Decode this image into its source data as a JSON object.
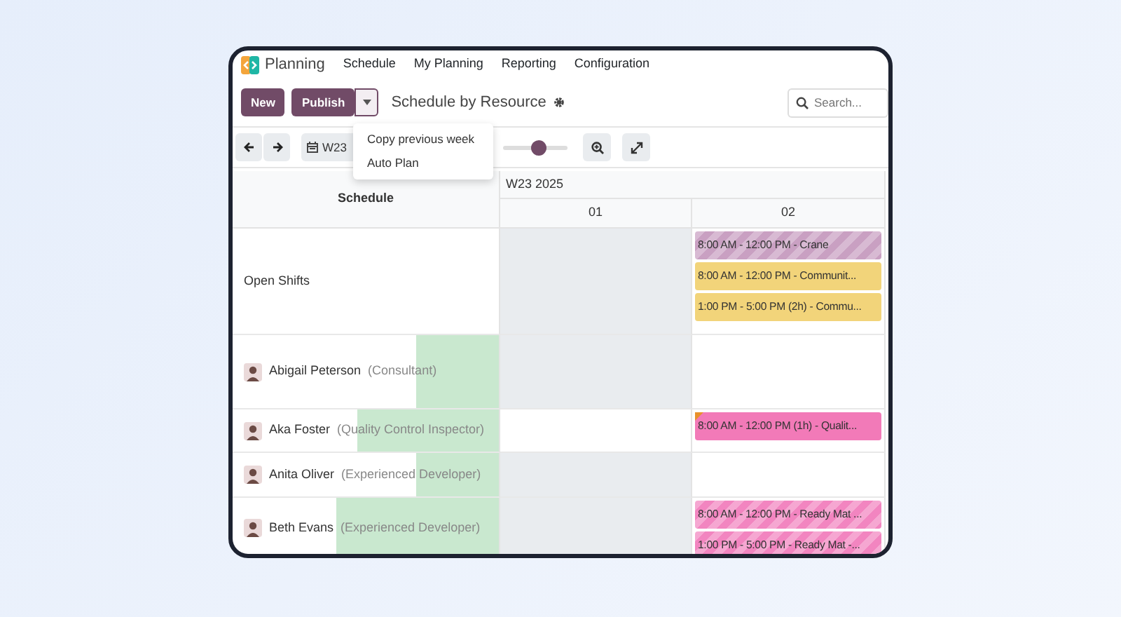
{
  "app": {
    "name": "Planning"
  },
  "menu": [
    "Schedule",
    "My Planning",
    "Reporting",
    "Configuration"
  ],
  "actions": {
    "new": "New",
    "publish": "Publish"
  },
  "view_title": "Schedule by Resource",
  "search": {
    "placeholder": "Search..."
  },
  "dropdown": {
    "expanded": true,
    "items": [
      "Copy previous week",
      "Auto Plan"
    ]
  },
  "toolbar": {
    "period": "W23",
    "zoom": {
      "level": 0.55
    }
  },
  "gantt": {
    "row_header": "Schedule",
    "period": "W23 2025",
    "days": [
      "01",
      "02"
    ],
    "rows": [
      {
        "kind": "group",
        "label": "Open Shifts",
        "cells": [
          {
            "greyed": true
          },
          {
            "greyed": false,
            "shifts": [
              {
                "text": "8:00 AM - 12:00 PM - Crane",
                "color": "#c9a0c2",
                "striped": true,
                "warning": false
              },
              {
                "text": "8:00 AM - 12:00 PM - Communit...",
                "color": "#f2d47a",
                "striped": false,
                "warning": false
              },
              {
                "text": "1:00 PM - 5:00 PM (2h) - Commu...",
                "color": "#f2d47a",
                "striped": false,
                "warning": false
              }
            ]
          }
        ]
      },
      {
        "kind": "resource",
        "name": "Abigail Peterson",
        "role": "(Consultant)",
        "level": 0.31,
        "cells": [
          {
            "greyed": true
          },
          {
            "greyed": false
          }
        ]
      },
      {
        "kind": "resource",
        "name": "Aka Foster",
        "role": "(Quality Control Inspector)",
        "level": 0.53,
        "cells": [
          {
            "greyed": false
          },
          {
            "greyed": false,
            "shifts": [
              {
                "text": "8:00 AM - 12:00 PM (1h) - Qualit...",
                "color": "#f27ab8",
                "striped": false,
                "warning": true
              }
            ]
          }
        ]
      },
      {
        "kind": "resource",
        "name": "Anita Oliver",
        "role": "(Experienced Developer)",
        "level": 0.31,
        "cells": [
          {
            "greyed": true
          },
          {
            "greyed": false
          }
        ]
      },
      {
        "kind": "resource",
        "name": "Beth Evans",
        "role": "(Experienced Developer)",
        "level": 0.61,
        "cells": [
          {
            "greyed": true
          },
          {
            "greyed": false,
            "shifts": [
              {
                "text": "8:00 AM - 12:00 PM - Ready Mat ...",
                "color": "#f285c0",
                "striped": true,
                "warning": false
              },
              {
                "text": "1:00 PM - 5:00 PM - Ready Mat -...",
                "color": "#f285c0",
                "striped": true,
                "warning": false
              }
            ]
          }
        ]
      }
    ]
  }
}
